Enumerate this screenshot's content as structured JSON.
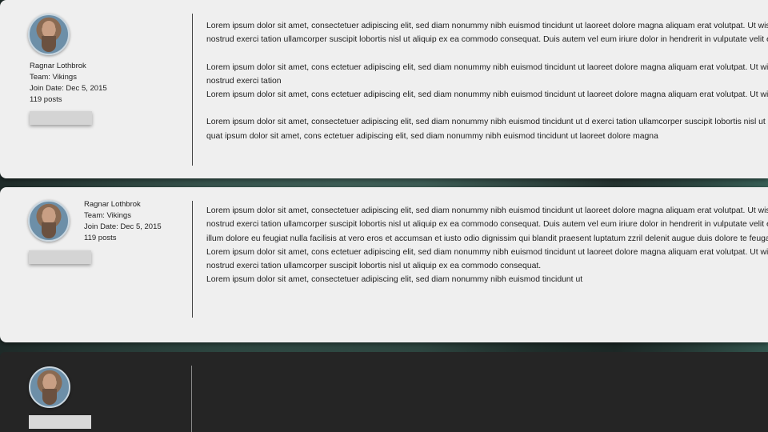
{
  "posts": [
    {
      "author": {
        "name": "Ragnar Lothbrok",
        "team": "Team: Vikings",
        "join_date": "Join Date: Dec 5, 2015",
        "posts": "119 posts"
      },
      "paragraphs": [
        [
          "Lorem ipsum dolor sit amet, consectetuer adipiscing elit, sed diam nonummy nibh euismod tincidunt ut laoreet dolore magna aliquam erat volutpat. Ut wisi enim ad minim veniam, quis",
          "nostrud exerci tation ullamcorper suscipit lobortis nisl ut aliquip ex ea commodo consequat. Duis autem vel eum iriure dolor in hendrerit in vulputate velit esse molestie consequat"
        ],
        [
          "Lorem ipsum dolor sit amet, cons ectetuer adipiscing elit, sed diam nonummy nibh euismod tincidunt ut laoreet dolore magna aliquam erat volutpat. Ut wisi enim ad minim veniam, quis",
          "nostrud exerci tation",
          "Lorem ipsum dolor sit amet, cons ectetuer adipiscing elit, sed diam nonummy nibh euismod tincidunt ut laoreet dolore magna aliquam erat volutpat. Ut wisi enim ad minim veniam, quis"
        ],
        [
          "Lorem ipsum dolor sit amet, consectetuer adipiscing elit, sed diam nonummy nibh euismod tincidunt ut d exerci tation ullamcorper suscipit lobortis nisl ut aliquip ex ea commodo",
          "quat ipsum dolor sit amet, cons ectetuer adipiscing elit, sed diam nonummy nibh euismod tincidunt ut laoreet dolore magna"
        ]
      ]
    },
    {
      "author": {
        "name": "Ragnar Lothbrok",
        "team": "Team: Vikings",
        "join_date": "Join Date: Dec 5, 2015",
        "posts": "119 posts"
      },
      "paragraphs": [
        [
          "Lorem ipsum dolor sit amet, consectetuer adipiscing elit, sed diam nonummy nibh euismod tincidunt ut laoreet dolore magna aliquam erat volutpat. Ut wisi enim ad minim veniam, quis",
          "nostrud exerci tation ullamcorper suscipit lobortis nisl ut aliquip ex ea commodo consequat. Duis autem vel eum iriure dolor in hendrerit in vulputate velit esse molestie consequat",
          "illum dolore eu feugiat nulla facilisis at vero eros et accumsan et iusto odio dignissim qui blandit praesent luptatum zzril delenit augue duis dolore te feugait nulla facilisi.",
          "Lorem ipsum dolor sit amet, cons ectetuer adipiscing elit, sed diam nonummy nibh euismod tincidunt ut laoreet dolore magna aliquam erat volutpat. Ut wisi enim ad minim veniam, quis",
          "nostrud exerci tation ullamcorper suscipit lobortis nisl ut aliquip ex ea commodo consequat.",
          "Lorem ipsum dolor sit amet, consectetuer adipiscing elit, sed diam nonummy nibh euismod tincidunt ut"
        ]
      ]
    }
  ],
  "colors": {
    "post_bg": "#efefef",
    "dark_post_bg": "#252525",
    "badge": "#d4d4d4",
    "text": "#1e1e1e"
  },
  "icons": {
    "avatar": "viking-avatar-icon"
  }
}
